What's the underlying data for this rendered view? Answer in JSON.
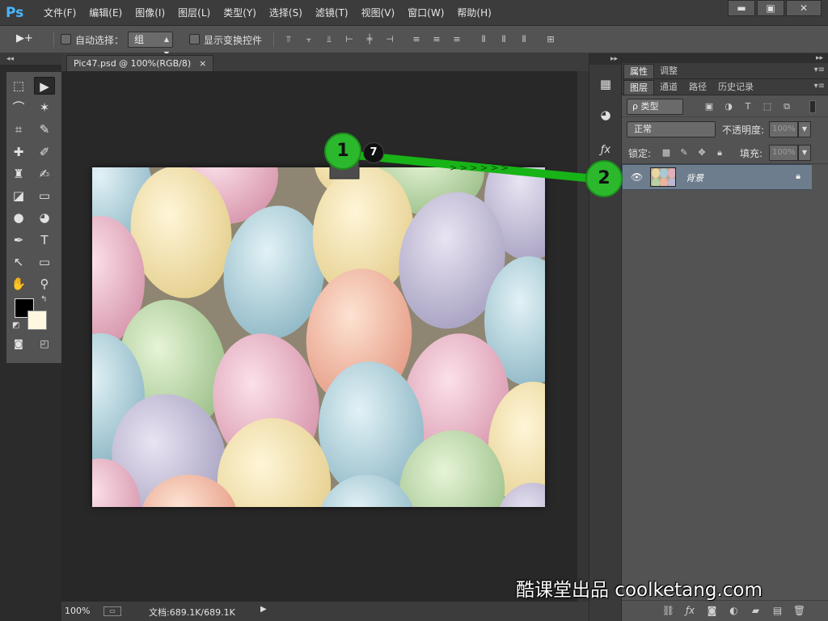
{
  "app": {
    "logo": "Ps"
  },
  "menu": [
    "文件(F)",
    "编辑(E)",
    "图像(I)",
    "图层(L)",
    "类型(Y)",
    "选择(S)",
    "滤镜(T)",
    "视图(V)",
    "窗口(W)",
    "帮助(H)"
  ],
  "window_controls": {
    "minimize": "▬",
    "maximize": "▣",
    "close": "✕"
  },
  "options_bar": {
    "tool_glyph": "▶+",
    "auto_select_label": "自动选择：",
    "auto_select_value": "组",
    "show_transform_label": "显示变换控件"
  },
  "document": {
    "tab_title": "Pic47.psd @ 100%(RGB/8)",
    "tab_close": "×",
    "zoom": "100%",
    "doc_info": "文档:689.1K/689.1K",
    "image_subject": "pastel colored eggs"
  },
  "layers_panel": {
    "top_tabs": [
      "属性",
      "调整"
    ],
    "tabs": [
      "图层",
      "通道",
      "路径",
      "历史记录"
    ],
    "filter_label": "ρ 类型",
    "blend_mode": "正常",
    "opacity_label": "不透明度:",
    "opacity_value": "100%",
    "lock_label": "锁定:",
    "fill_label": "填充:",
    "fill_value": "100%",
    "layers": [
      {
        "name": "背景",
        "visible": true,
        "locked": true
      }
    ]
  },
  "annotations": {
    "step1": "1",
    "step2": "2",
    "badge": "7",
    "color": "#2cb82c"
  },
  "watermark": "酷课堂出品 coolketang.com"
}
